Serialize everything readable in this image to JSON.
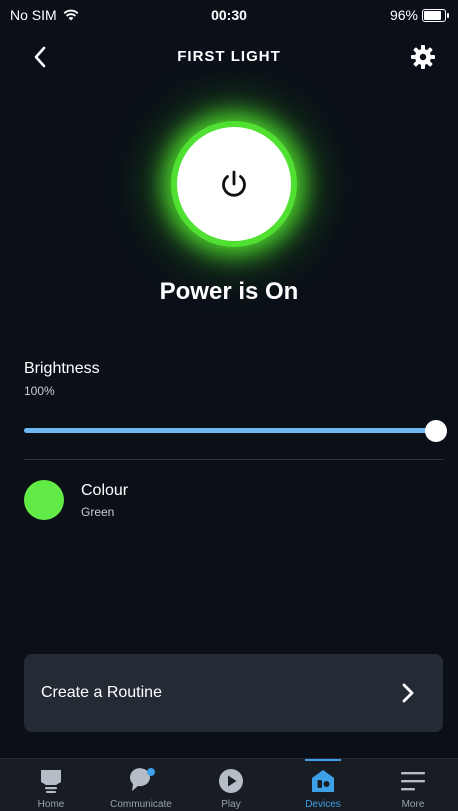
{
  "status_bar": {
    "carrier": "No SIM",
    "time": "00:30",
    "battery": "96%",
    "battery_level": 0.96
  },
  "header": {
    "title": "FIRST LIGHT"
  },
  "power": {
    "status": "Power is On",
    "glow_color": "#50e032"
  },
  "brightness": {
    "label": "Brightness",
    "value": "100%",
    "level": 1.0
  },
  "colour": {
    "label": "Colour",
    "value": "Green",
    "swatch_color": "#62ea46"
  },
  "routine": {
    "label": "Create a Routine"
  },
  "tabs": [
    {
      "label": "Home",
      "icon": "home-icon"
    },
    {
      "label": "Communicate",
      "icon": "chat-bubble-icon"
    },
    {
      "label": "Play",
      "icon": "play-icon"
    },
    {
      "label": "Devices",
      "icon": "devices-icon",
      "active": true
    },
    {
      "label": "More",
      "icon": "menu-lines-icon"
    }
  ],
  "colors": {
    "accent": "#3da0e8",
    "background": "#0b1018",
    "card": "#252b35"
  }
}
